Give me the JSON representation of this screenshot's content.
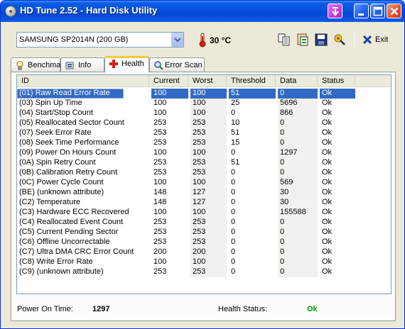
{
  "window": {
    "title": "HD Tune 2.52 - Hard Disk Utility"
  },
  "toolbar": {
    "drive": "SAMSUNG SP2014N (200 GB)",
    "temperature": "30 °C",
    "exit_label": "Exit",
    "icons": [
      "copy-icon",
      "copy-text-icon",
      "save-icon",
      "options-icon"
    ]
  },
  "tabs": [
    {
      "label": "Benchmark",
      "icon": "bulb-icon"
    },
    {
      "label": "Info",
      "icon": "info-icon"
    },
    {
      "label": "Health",
      "icon": "health-cross-icon",
      "active": true
    },
    {
      "label": "Error Scan",
      "icon": "magnifier-icon"
    }
  ],
  "grid": {
    "columns": [
      "ID",
      "Current",
      "Worst",
      "Threshold",
      "Data",
      "Status"
    ],
    "rows": [
      [
        "(01) Raw Read Error Rate",
        "100",
        "100",
        "51",
        "0",
        "Ok"
      ],
      [
        "(03) Spin Up Time",
        "100",
        "100",
        "25",
        "5696",
        "Ok"
      ],
      [
        "(04) Start/Stop Count",
        "100",
        "100",
        "0",
        "866",
        "Ok"
      ],
      [
        "(05) Reallocated Sector Count",
        "253",
        "253",
        "10",
        "0",
        "Ok"
      ],
      [
        "(07) Seek Error Rate",
        "253",
        "253",
        "51",
        "0",
        "Ok"
      ],
      [
        "(08) Seek Time Performance",
        "253",
        "253",
        "15",
        "0",
        "Ok"
      ],
      [
        "(09) Power On Hours Count",
        "100",
        "100",
        "0",
        "1297",
        "Ok"
      ],
      [
        "(0A) Spin Retry Count",
        "253",
        "253",
        "51",
        "0",
        "Ok"
      ],
      [
        "(0B) Calibration Retry Count",
        "253",
        "253",
        "0",
        "0",
        "Ok"
      ],
      [
        "(0C) Power Cycle Count",
        "100",
        "100",
        "0",
        "569",
        "Ok"
      ],
      [
        "(BE) (unknown attribute)",
        "148",
        "127",
        "0",
        "30",
        "Ok"
      ],
      [
        "(C2) Temperature",
        "148",
        "127",
        "0",
        "30",
        "Ok"
      ],
      [
        "(C3) Hardware ECC Recovered",
        "100",
        "100",
        "0",
        "155588",
        "Ok"
      ],
      [
        "(C4) Reallocated Event Count",
        "253",
        "253",
        "0",
        "0",
        "Ok"
      ],
      [
        "(C5) Current Pending Sector",
        "253",
        "253",
        "0",
        "0",
        "Ok"
      ],
      [
        "(C6) Offline Uncorrectable",
        "253",
        "253",
        "0",
        "0",
        "Ok"
      ],
      [
        "(C7) Ultra DMA CRC Error Count",
        "200",
        "200",
        "0",
        "0",
        "Ok"
      ],
      [
        "(C8) Write Error Rate",
        "100",
        "100",
        "0",
        "0",
        "Ok"
      ],
      [
        "(C9) (unknown attribute)",
        "253",
        "253",
        "0",
        "0",
        "Ok"
      ]
    ],
    "selected_row": 0
  },
  "footer": {
    "power_on_label": "Power On Time:",
    "power_on_value": "1297",
    "health_label": "Health Status:",
    "health_value": "Ok"
  },
  "colors": {
    "selection": "#316ac5",
    "health_ok": "#00a000",
    "titlebar": "#0551dc",
    "temperature_icon": "#d02010"
  }
}
